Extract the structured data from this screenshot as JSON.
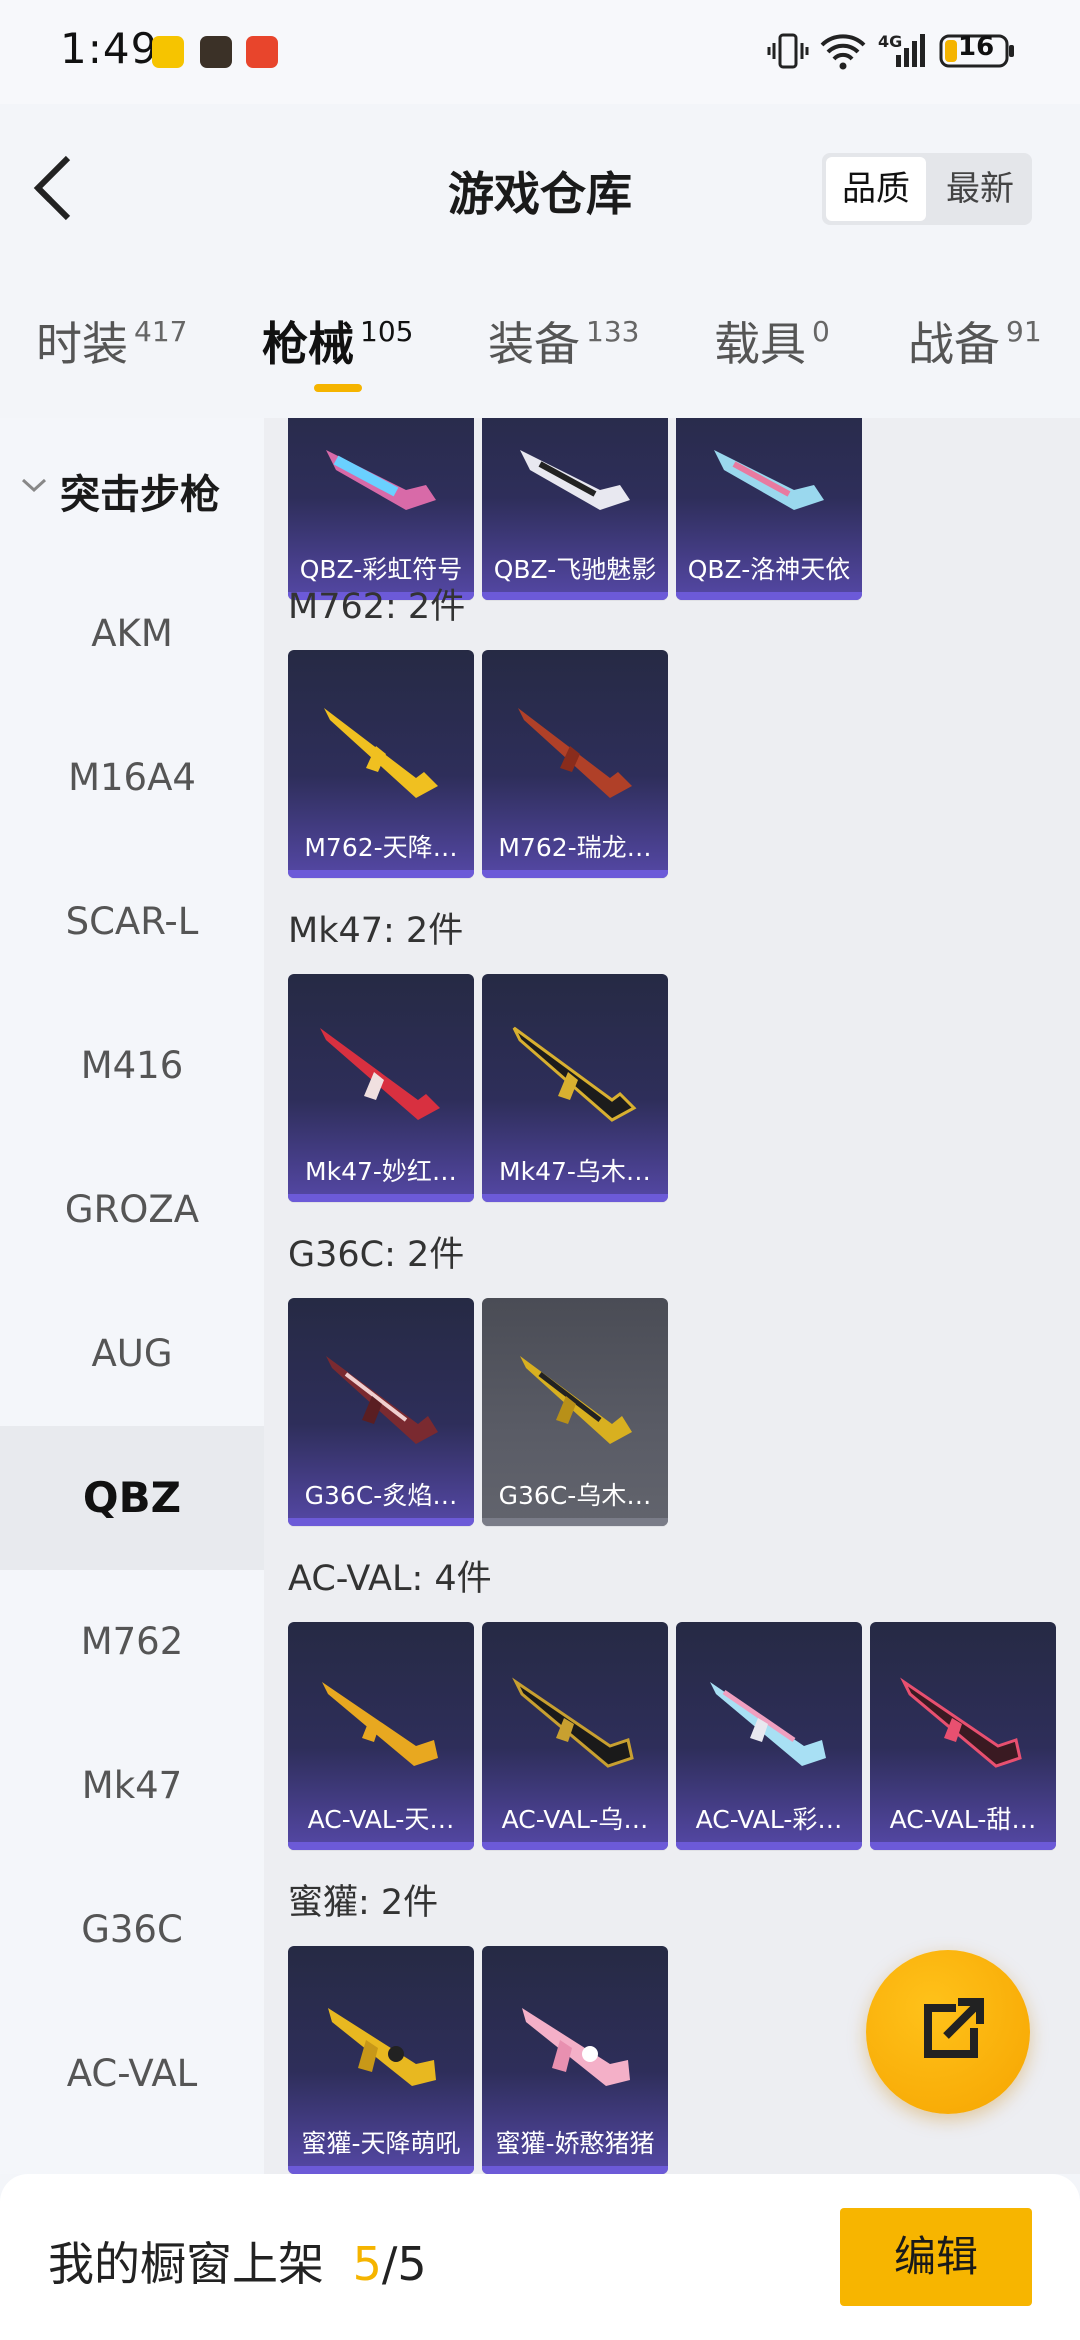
{
  "status_bar": {
    "time": "1:49",
    "battery": "16",
    "network": "4G"
  },
  "header": {
    "title": "游戏仓库",
    "sort_active": "品质",
    "sort_inactive": "最新"
  },
  "tabs": [
    {
      "label": "时装",
      "count": "417"
    },
    {
      "label": "枪械",
      "count": "105"
    },
    {
      "label": "装备",
      "count": "133"
    },
    {
      "label": "载具",
      "count": "0"
    },
    {
      "label": "战备",
      "count": "91"
    }
  ],
  "sidebar": {
    "category": "突击步枪",
    "items": [
      "AKM",
      "M16A4",
      "SCAR-L",
      "M416",
      "GROZA",
      "AUG",
      "QBZ",
      "M762",
      "Mk47",
      "G36C",
      "AC-VAL"
    ],
    "selected": "QBZ"
  },
  "groups": {
    "qbz": {
      "items": [
        "QBZ-彩虹符号",
        "QBZ-飞驰魅影",
        "QBZ-洛神天依"
      ]
    },
    "m762": {
      "title": "M762: 2件",
      "items": [
        "M762-天降…",
        "M762-瑞龙…"
      ]
    },
    "mk47": {
      "title": "Mk47: 2件",
      "items": [
        "Mk47-妙红…",
        "Mk47-乌木…"
      ]
    },
    "g36c": {
      "title": "G36C: 2件",
      "items": [
        "G36C-炙焰…",
        "G36C-乌木…"
      ]
    },
    "acval": {
      "title": "AC-VAL: 4件",
      "items": [
        "AC-VAL-天…",
        "AC-VAL-乌…",
        "AC-VAL-彩…",
        "AC-VAL-甜…"
      ]
    },
    "honey": {
      "title": "蜜獾: 2件",
      "items": [
        "蜜獾-天降萌吼",
        "蜜獾-娇憨猪猪"
      ]
    }
  },
  "bottom_bar": {
    "label": "我的橱窗上架",
    "current": "5",
    "sep": "/",
    "total": "5",
    "edit_label": "编辑"
  },
  "colors": {
    "accent": "#f5b400",
    "card_bg": "#2e2e5a",
    "card_bar": "#6c5ad8"
  }
}
